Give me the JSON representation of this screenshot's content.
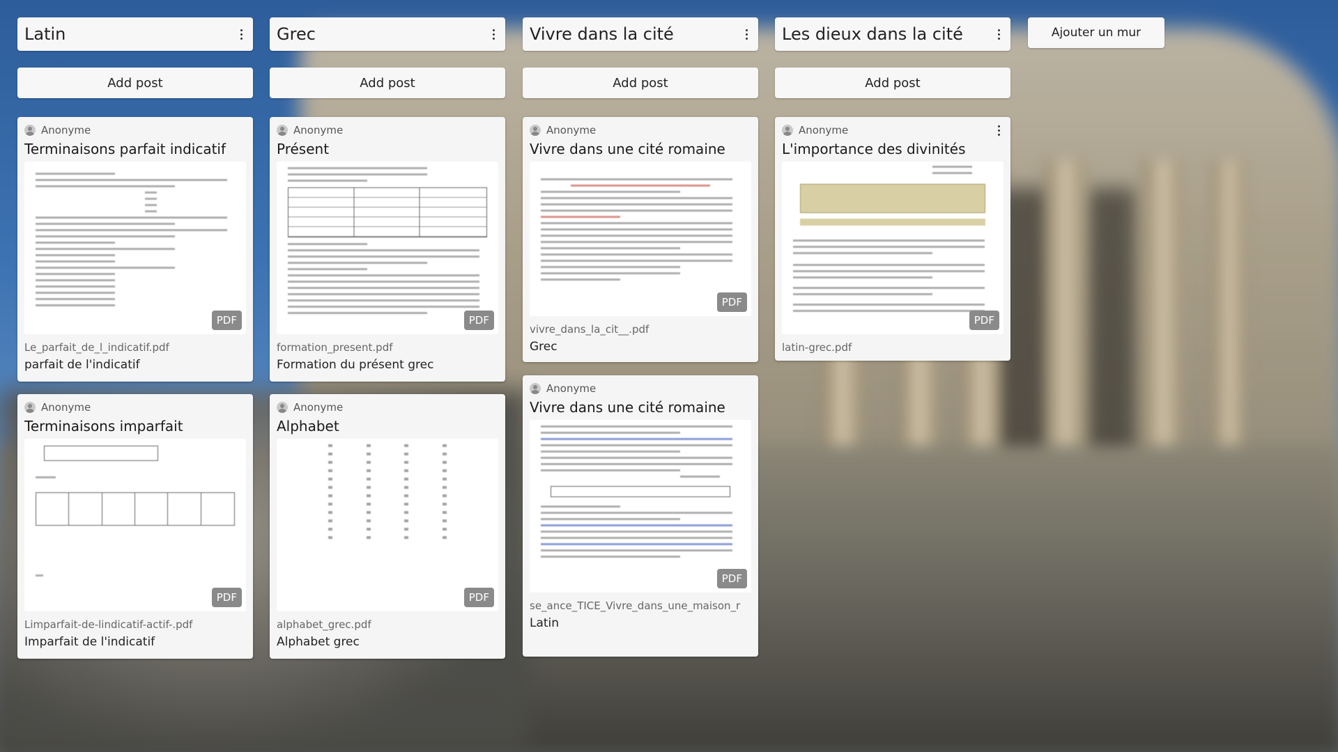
{
  "add_post_label": "Add post",
  "pdf_badge": "PDF",
  "add_wall_label": "Ajouter un mur",
  "columns": [
    {
      "title": "Latin",
      "cards": [
        {
          "author": "Anonyme",
          "title": "Terminaisons parfait indicatif",
          "file": "Le_parfait_de_l_indicatif.pdf",
          "desc": "parfait de l'indicatif"
        },
        {
          "author": "Anonyme",
          "title": "Terminaisons imparfait",
          "file": "Limparfait-de-lindicatif-actif-.pdf",
          "desc": "Imparfait de l'indicatif"
        }
      ]
    },
    {
      "title": "Grec",
      "cards": [
        {
          "author": "Anonyme",
          "title": "Présent",
          "file": "formation_present.pdf",
          "desc": "Formation du présent grec"
        },
        {
          "author": "Anonyme",
          "title": "Alphabet",
          "file": "alphabet_grec.pdf",
          "desc": "Alphabet grec"
        }
      ]
    },
    {
      "title": "Vivre dans la cité",
      "cards": [
        {
          "author": "Anonyme",
          "title": "Vivre dans une cité romaine",
          "file": "vivre_dans_la_cit__.pdf",
          "desc": "Grec"
        },
        {
          "author": "Anonyme",
          "title": "Vivre dans une cité romaine",
          "file": "se_ance_TICE_Vivre_dans_une_maison_r",
          "desc": "Latin"
        }
      ]
    },
    {
      "title": "Les dieux dans la cité",
      "cards": [
        {
          "author": "Anonyme",
          "title": "L'importance des divinités",
          "file": "latin-grec.pdf",
          "desc": ""
        }
      ]
    }
  ],
  "icons": {
    "column_menu": "kebab-icon",
    "avatar": "user-avatar-icon"
  }
}
